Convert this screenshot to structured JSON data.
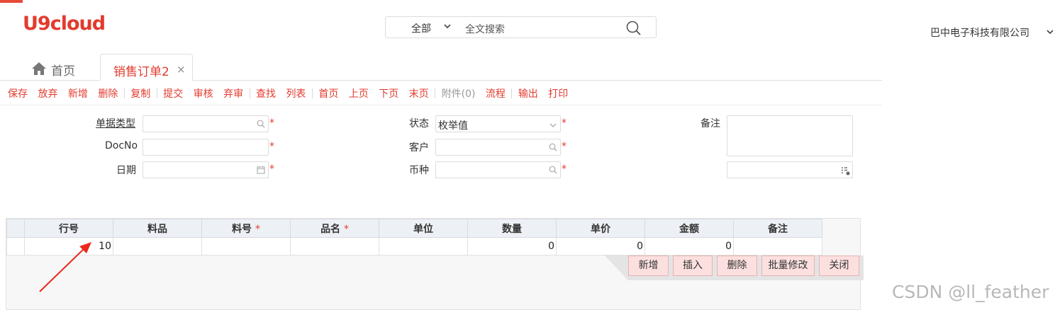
{
  "header": {
    "logo": "U9cloud",
    "company": "巴中电子科技有限公司"
  },
  "search": {
    "scope": "全部",
    "placeholder": "全文搜索"
  },
  "tabs": {
    "home": "首页",
    "active": "销售订单2",
    "close": "×"
  },
  "toolbar": {
    "save": "保存",
    "discard": "放弃",
    "new": "新增",
    "delete": "删除",
    "copy": "复制",
    "submit": "提交",
    "approve": "审核",
    "abandon": "弃审",
    "find": "查找",
    "list": "列表",
    "first": "首页",
    "prev": "上页",
    "next": "下页",
    "last": "末页",
    "attachment": "附件(0)",
    "flow": "流程",
    "output": "输出",
    "print": "打印"
  },
  "form": {
    "doc_type_label": "单据类型",
    "docno_label": "DocNo",
    "date_label": "日期",
    "status_label": "状态",
    "status_value": "枚举值",
    "customer_label": "客户",
    "currency_label": "币种",
    "remark_label": "备注",
    "required_mark": "*"
  },
  "grid": {
    "headers": [
      "行号",
      "料品",
      "料号",
      "品名",
      "单位",
      "数量",
      "单价",
      "金额",
      "备注"
    ],
    "required_mark": "*",
    "row": [
      "10",
      "",
      "",
      "",
      "",
      "0",
      "0",
      "0",
      ""
    ],
    "buttons": {
      "add": "新增",
      "insert": "插入",
      "delete": "删除",
      "batch_edit": "批量修改",
      "close": "关闭"
    }
  },
  "watermark": "CSDN @ll_feather",
  "colors": {
    "brand": "#e23b2e",
    "toolbar_text": "#e23b2e",
    "grid_header": "#edf0f5",
    "grid_button": "#fbe0df",
    "annotation_arrow": "#e8291c"
  }
}
